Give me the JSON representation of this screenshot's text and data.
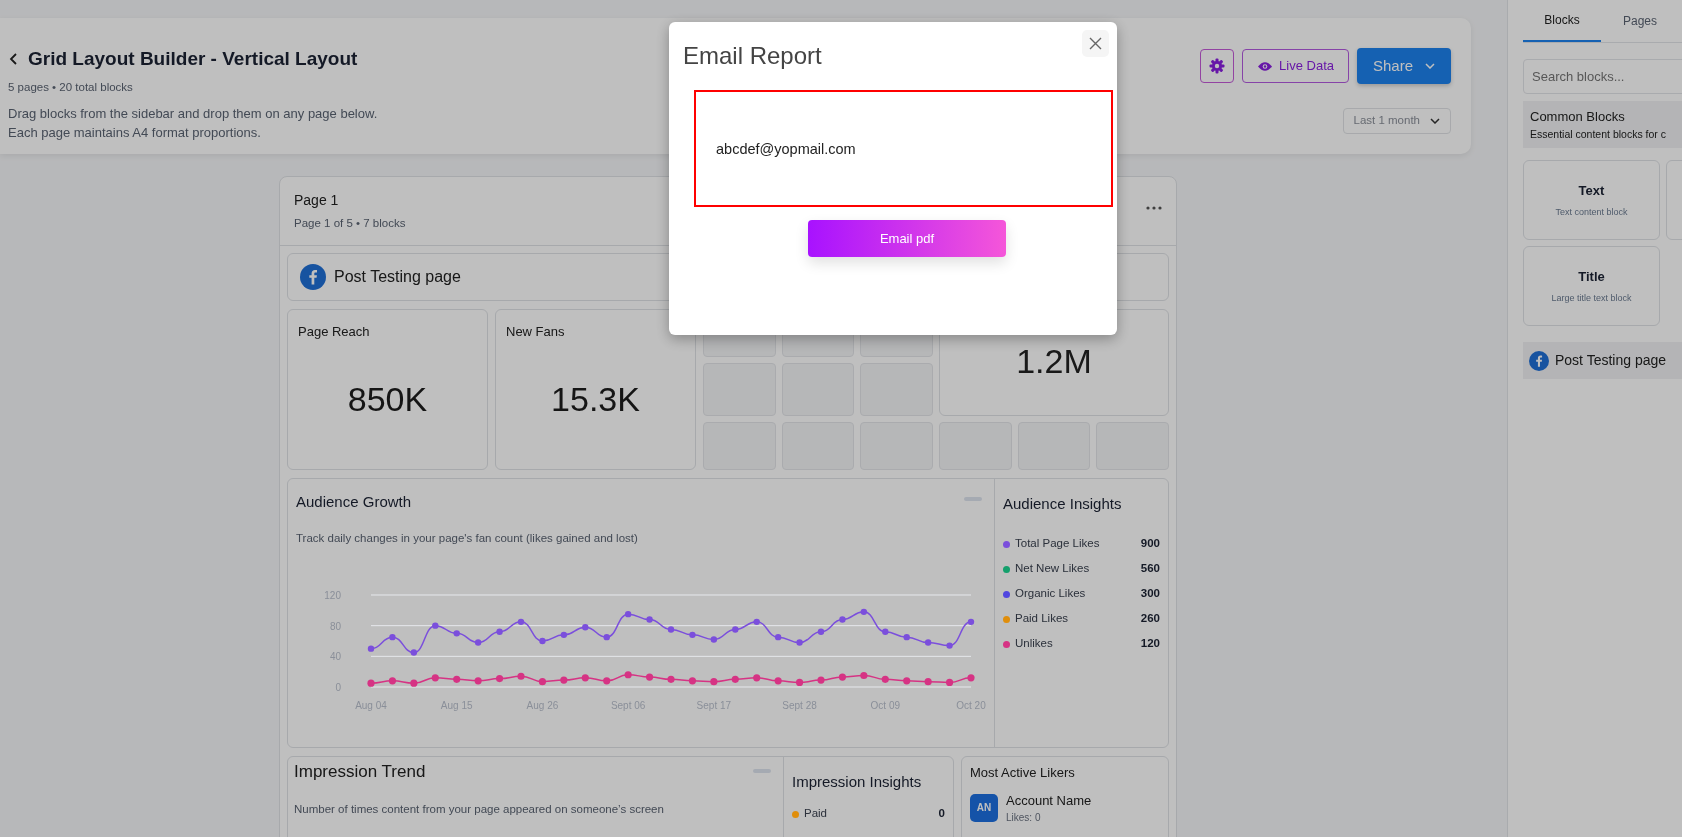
{
  "header": {
    "title": "Grid Layout Builder - Vertical Layout",
    "subtitle": "5 pages • 20 total blocks",
    "description": [
      "Drag blocks from the sidebar and drop them on any page below.",
      "Each page maintains A4 format proportions."
    ],
    "live_data": "Live Data",
    "share": "Share",
    "date_range": "Last 1 month"
  },
  "page": {
    "title": "Page 1",
    "subtitle": "Page 1 of 5 • 7 blocks",
    "source": {
      "name": "Post Testing page"
    },
    "stats": [
      {
        "label": "Page Reach",
        "value": "850K"
      },
      {
        "label": "New Fans",
        "value": "15.3K"
      }
    ],
    "stat_partial": {
      "value": "1.2M"
    },
    "audience_growth": {
      "title": "Audience Growth",
      "description": "Track daily changes in your page's fan count (likes gained and lost)",
      "chart_data": {
        "type": "line",
        "categories": [
          "Aug 04",
          null,
          null,
          null,
          "Aug 15",
          null,
          null,
          null,
          "Aug 26",
          null,
          null,
          null,
          "Sept 06",
          null,
          null,
          null,
          "Sept 17",
          null,
          null,
          null,
          "Sept 28",
          null,
          null,
          null,
          "Oct 09",
          null,
          null,
          null,
          "Oct 20"
        ],
        "ylim": [
          0,
          120
        ],
        "yticks": [
          0,
          40,
          80,
          120
        ],
        "series": [
          {
            "color": "#7b4fdc",
            "marker": "circle",
            "values": [
              50,
              65,
              45,
              80,
              70,
              58,
              72,
              85,
              60,
              68,
              78,
              65,
              95,
              88,
              75,
              68,
              62,
              75,
              85,
              65,
              58,
              72,
              88,
              98,
              72,
              65,
              58,
              54,
              85
            ]
          },
          {
            "color": "#d63384",
            "marker": "circle",
            "values": [
              5,
              8,
              5,
              12,
              10,
              8,
              11,
              14,
              7,
              9,
              12,
              8,
              16,
              13,
              10,
              8,
              7,
              10,
              12,
              8,
              6,
              9,
              13,
              15,
              10,
              8,
              7,
              6,
              12
            ]
          }
        ]
      }
    },
    "audience_insights": {
      "title": "Audience Insights",
      "items": [
        {
          "label": "Total Page Likes",
          "value": "900",
          "color": "#7b4fdc"
        },
        {
          "label": "Net New Likes",
          "value": "560",
          "color": "#14a06c"
        },
        {
          "label": "Organic Likes",
          "value": "300",
          "color": "#5046e0"
        },
        {
          "label": "Paid Likes",
          "value": "260",
          "color": "#e08e0b"
        },
        {
          "label": "Unlikes",
          "value": "120",
          "color": "#d63384"
        }
      ]
    },
    "impression_trend": {
      "title": "Impression Trend",
      "description": "Number of times content from your page appeared on someone’s screen"
    },
    "impression_insights": {
      "title": "Impression Insights",
      "items": [
        {
          "label": "Paid",
          "value": "0",
          "color": "#e08e0b"
        }
      ]
    },
    "most_active_likers": {
      "title": "Most Active Likers",
      "items": [
        {
          "initials": "AN",
          "name": "Account Name",
          "likes": "Likes: 0"
        }
      ]
    }
  },
  "sidebar": {
    "tabs": [
      {
        "label": "Blocks",
        "selected": true
      },
      {
        "label": "Pages",
        "selected": false
      }
    ],
    "search": {
      "placeholder": "Search blocks..."
    },
    "section": {
      "title": "Common Blocks",
      "description": "Essential content blocks for c"
    },
    "blocks": [
      {
        "title": "Text",
        "description": "Text content block"
      },
      {
        "title": "Title",
        "description": "Large title text block"
      }
    ],
    "sources": [
      {
        "name": "Post Testing page"
      }
    ]
  },
  "modal": {
    "title": "Email Report",
    "email": "abcdef@yopmail.com",
    "button": "Email pdf"
  }
}
